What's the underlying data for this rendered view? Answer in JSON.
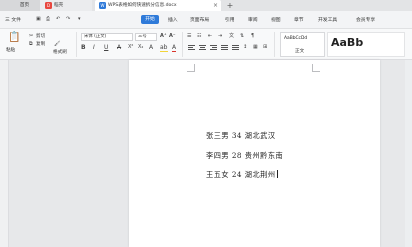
{
  "titlebar": {
    "tabs": [
      {
        "label": "首页"
      },
      {
        "label": "稻壳",
        "icon_text": "D"
      },
      {
        "label": "WPS表格如何快速拆分信息.docx",
        "icon_text": "W"
      }
    ],
    "new_tab": "+"
  },
  "menubar": {
    "file": "三 文件",
    "items": [
      "开始",
      "插入",
      "页面布局",
      "引用",
      "审阅",
      "视图",
      "章节",
      "开发工具",
      "会员专享"
    ],
    "active": "开始"
  },
  "ribbon": {
    "paste": "粘贴",
    "cut": "剪切",
    "copy": "复制",
    "format_painter": "格式刷",
    "font_name": "宋体 (正文)",
    "font_size": "三号",
    "style_normal": "正文",
    "style_preview": "AaBbCcDd",
    "heading_preview": "AaBb"
  },
  "document": {
    "lines": [
      "张三男 34 湖北武汉",
      "李四男 28 贵州黔东南",
      "王五女 24 湖北荆州"
    ]
  }
}
